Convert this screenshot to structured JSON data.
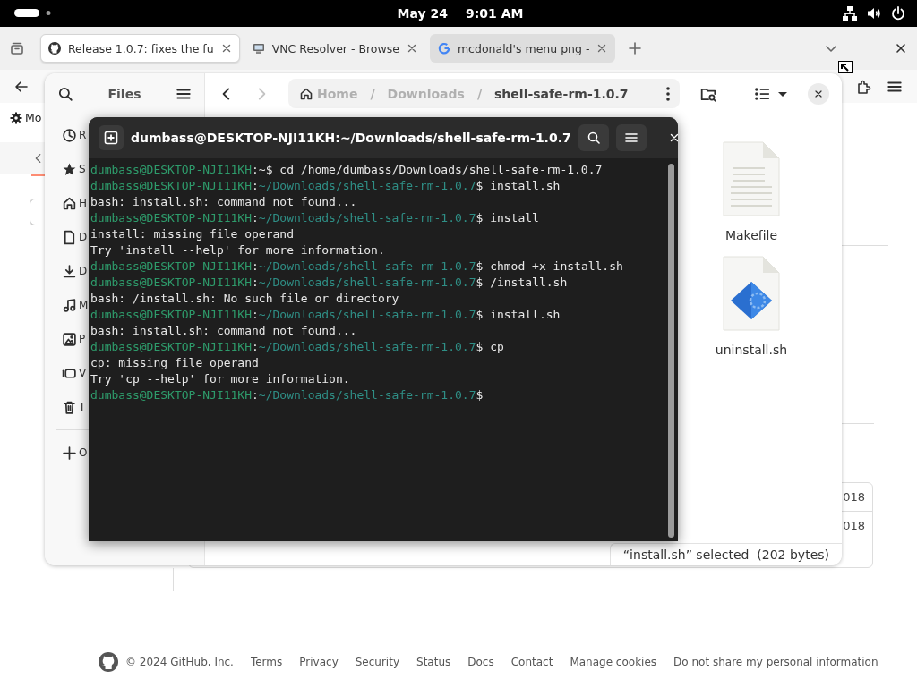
{
  "top_bar": {
    "date": "May 24",
    "time": "9:01 AM"
  },
  "browser": {
    "tabs": [
      {
        "title": "Release 1.0.7: fixes the fu",
        "kind": "github",
        "selected": true,
        "highlighted": false
      },
      {
        "title": "VNC Resolver - Browse",
        "kind": "vnc",
        "selected": false,
        "highlighted": false
      },
      {
        "title": "mcdonald's menu png -",
        "kind": "google",
        "selected": false,
        "highlighted": true
      }
    ],
    "bookmark": "Mo",
    "page": {
      "table_cells": [
        "018",
        "018"
      ],
      "footer": {
        "copyright": "© 2024 GitHub, Inc.",
        "links": [
          "Terms",
          "Privacy",
          "Security",
          "Status",
          "Docs",
          "Contact",
          "Manage cookies",
          "Do not share my personal information"
        ]
      }
    }
  },
  "files": {
    "title": "Files",
    "sidebar": [
      {
        "kind": "recent",
        "label": "R"
      },
      {
        "kind": "starred",
        "label": "S"
      },
      {
        "kind": "home",
        "label": "H"
      },
      {
        "kind": "documents",
        "label": "D"
      },
      {
        "kind": "downloads",
        "label": "D"
      },
      {
        "kind": "music",
        "label": "M"
      },
      {
        "kind": "pictures",
        "label": "P"
      },
      {
        "kind": "videos",
        "label": "V"
      },
      {
        "kind": "trash",
        "label": "T"
      },
      {
        "kind": "other",
        "label": "O"
      }
    ],
    "breadcrumbs": [
      {
        "label": "Home",
        "current": false
      },
      {
        "label": "Downloads",
        "current": false
      },
      {
        "label": "shell-safe-rm-1.0.7",
        "current": true
      }
    ],
    "separator": "/",
    "items": [
      {
        "name": "Makefile",
        "kind": "text"
      },
      {
        "name": "uninstall.sh",
        "kind": "script"
      }
    ],
    "status": "“install.sh” selected  (202 bytes)"
  },
  "terminal": {
    "title": "dumbass@DESKTOP-NJI11KH:~/Downloads/shell-safe-rm-1.0.7",
    "lines": [
      {
        "kind": "prompt",
        "user": "dumbass@DESKTOP-NJI11KH",
        "sep": ":",
        "path": "~",
        "symbol": "$",
        "command": "cd /home/dumbass/Downloads/shell-safe-rm-1.0.7"
      },
      {
        "kind": "prompt",
        "user": "dumbass@DESKTOP-NJI11KH",
        "sep": ":",
        "path": "~/Downloads/shell-safe-rm-1.0.7",
        "symbol": "$",
        "command": "install.sh"
      },
      {
        "kind": "output",
        "text": "bash: install.sh: command not found..."
      },
      {
        "kind": "prompt",
        "user": "dumbass@DESKTOP-NJI11KH",
        "sep": ":",
        "path": "~/Downloads/shell-safe-rm-1.0.7",
        "symbol": "$",
        "command": "install"
      },
      {
        "kind": "output",
        "text": "install: missing file operand"
      },
      {
        "kind": "output",
        "text": "Try 'install --help' for more information."
      },
      {
        "kind": "prompt",
        "user": "dumbass@DESKTOP-NJI11KH",
        "sep": ":",
        "path": "~/Downloads/shell-safe-rm-1.0.7",
        "symbol": "$",
        "command": "chmod +x install.sh"
      },
      {
        "kind": "prompt",
        "user": "dumbass@DESKTOP-NJI11KH",
        "sep": ":",
        "path": "~/Downloads/shell-safe-rm-1.0.7",
        "symbol": "$",
        "command": "/install.sh"
      },
      {
        "kind": "output",
        "text": "bash: /install.sh: No such file or directory"
      },
      {
        "kind": "prompt",
        "user": "dumbass@DESKTOP-NJI11KH",
        "sep": ":",
        "path": "~/Downloads/shell-safe-rm-1.0.7",
        "symbol": "$",
        "command": "install.sh"
      },
      {
        "kind": "output",
        "text": "bash: install.sh: command not found..."
      },
      {
        "kind": "prompt",
        "user": "dumbass@DESKTOP-NJI11KH",
        "sep": ":",
        "path": "~/Downloads/shell-safe-rm-1.0.7",
        "symbol": "$",
        "command": "cp"
      },
      {
        "kind": "output",
        "text": "cp: missing file operand"
      },
      {
        "kind": "output",
        "text": "Try 'cp --help' for more information."
      },
      {
        "kind": "prompt",
        "user": "dumbass@DESKTOP-NJI11KH",
        "sep": ":",
        "path": "~/Downloads/shell-safe-rm-1.0.7",
        "symbol": "$"
      }
    ]
  }
}
